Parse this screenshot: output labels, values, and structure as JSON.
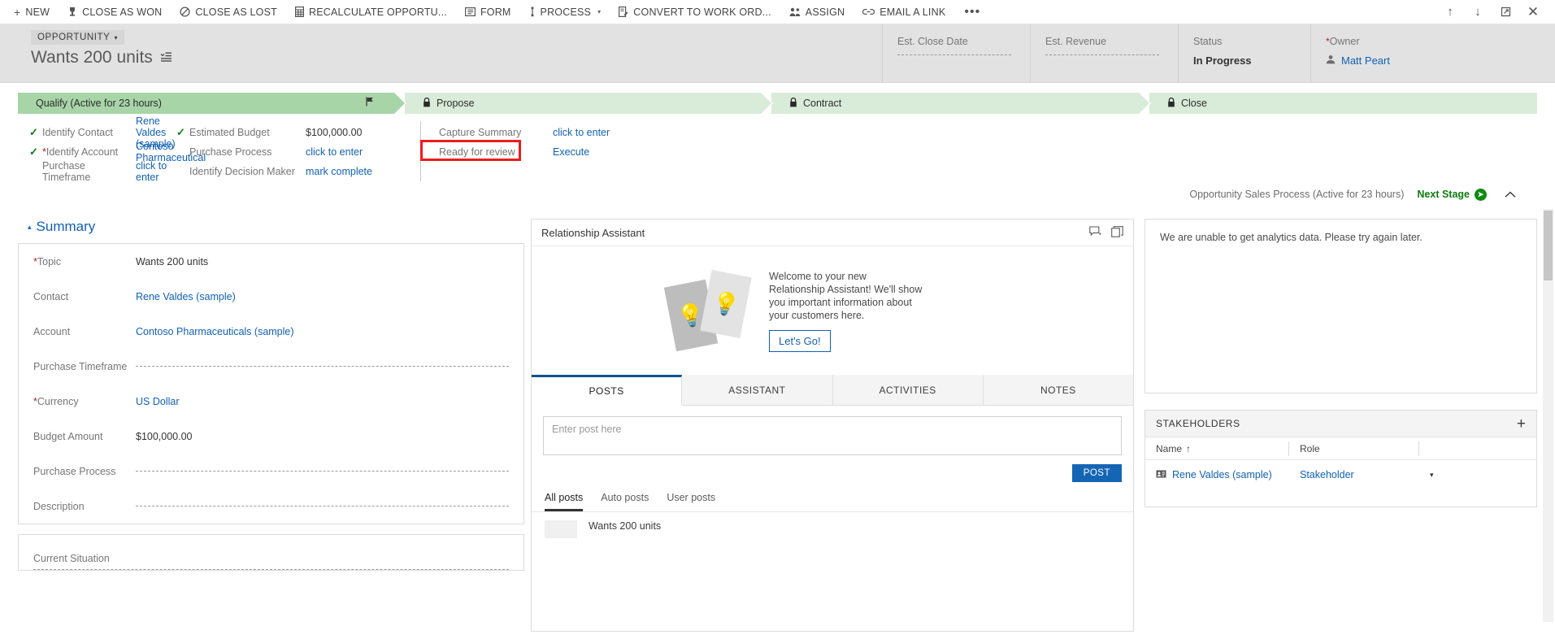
{
  "commandbar": {
    "items": [
      {
        "label": "NEW",
        "icon": "plus-icon",
        "glyph": "+"
      },
      {
        "label": "CLOSE AS WON",
        "icon": "trophy-icon",
        "glyph": "♟"
      },
      {
        "label": "CLOSE AS LOST",
        "icon": "no-entry-icon",
        "glyph": "⃠"
      },
      {
        "label": "RECALCULATE OPPORTU...",
        "icon": "calculator-icon",
        "glyph": "▤"
      },
      {
        "label": "FORM",
        "icon": "form-icon",
        "glyph": "▥"
      },
      {
        "label": "PROCESS",
        "icon": "process-icon",
        "glyph": "↕",
        "caret": "▾"
      },
      {
        "label": "CONVERT TO WORK ORD...",
        "icon": "work-order-icon",
        "glyph": "Ὅd"
      },
      {
        "label": "ASSIGN",
        "icon": "assign-user-icon",
        "glyph": "♟"
      },
      {
        "label": "EMAIL A LINK",
        "icon": "link-icon",
        "glyph": "∞"
      }
    ],
    "overflow_label": "•••",
    "right_icons": [
      {
        "name": "previous-record-icon",
        "glyph": "↑"
      },
      {
        "name": "next-record-icon",
        "glyph": "↓"
      },
      {
        "name": "popout-icon",
        "glyph": "⬚"
      },
      {
        "name": "close-icon",
        "glyph": "✕"
      }
    ]
  },
  "header": {
    "entity_label": "OPPORTUNITY",
    "entity_caret": "▾",
    "record_title": "Wants 200 units",
    "form_selector_icon": "form-selector-icon",
    "stats": [
      {
        "label": "Est. Close Date",
        "value": "",
        "empty": true
      },
      {
        "label": "Est. Revenue",
        "value": "",
        "empty": true
      },
      {
        "label": "Status",
        "value": "In Progress",
        "empty": false
      },
      {
        "label": "Owner",
        "value": "Matt Peart",
        "empty": false,
        "required": true,
        "link": true
      }
    ]
  },
  "bpf": {
    "stages": [
      {
        "label": "Qualify (Active for 23 hours)",
        "active": true,
        "locked": false
      },
      {
        "label": "Propose",
        "active": false,
        "locked": true
      },
      {
        "label": "Contract",
        "active": false,
        "locked": true
      },
      {
        "label": "Close",
        "active": false,
        "locked": true
      }
    ],
    "columns": [
      {
        "steps": [
          {
            "label": "Identify Contact",
            "value": "Rene Valdes (sample)",
            "complete": true,
            "required": false,
            "link": true
          },
          {
            "label": "Identify Account",
            "value": "Contoso Pharmaceutical",
            "complete": true,
            "required": true,
            "link": true
          },
          {
            "label": "Purchase Timeframe",
            "value": "click to enter",
            "complete": false,
            "required": false,
            "link": true
          }
        ]
      },
      {
        "steps": [
          {
            "label": "Estimated Budget",
            "value": "$100,000.00",
            "complete": true,
            "required": false,
            "link": false
          },
          {
            "label": "Purchase Process",
            "value": "click to enter",
            "complete": false,
            "required": false,
            "link": true
          },
          {
            "label": "Identify Decision Maker",
            "value": "mark complete",
            "complete": false,
            "required": false,
            "link": true
          }
        ]
      },
      {
        "steps": [
          {
            "label": "Capture Summary",
            "value": "click to enter",
            "complete": false,
            "required": false,
            "link": true
          },
          {
            "label": "Ready for review",
            "value": "Execute",
            "complete": false,
            "required": false,
            "link": true,
            "highlighted": true
          }
        ]
      }
    ],
    "process_name": "Opportunity Sales Process (Active for 23 hours)",
    "next_stage_label": "Next Stage",
    "next_stage_glyph": "➜",
    "collapse_glyph": "⌃"
  },
  "summary": {
    "section_title": "Summary",
    "section_caret": "▴",
    "fields": [
      {
        "label": "Topic",
        "value": "Wants 200 units",
        "required": true,
        "link": false,
        "empty": false
      },
      {
        "label": "Contact",
        "value": "Rene Valdes (sample)",
        "required": false,
        "link": true,
        "empty": false
      },
      {
        "label": "Account",
        "value": "Contoso Pharmaceuticals (sample)",
        "required": false,
        "link": true,
        "empty": false
      },
      {
        "label": "Purchase Timeframe",
        "value": "",
        "required": false,
        "link": false,
        "empty": true
      },
      {
        "label": "Currency",
        "value": "US Dollar",
        "required": true,
        "link": true,
        "empty": false
      },
      {
        "label": "Budget Amount",
        "value": "$100,000.00",
        "required": false,
        "link": false,
        "empty": false
      },
      {
        "label": "Purchase Process",
        "value": "",
        "required": false,
        "link": false,
        "empty": true
      },
      {
        "label": "Description",
        "value": "",
        "required": false,
        "link": false,
        "empty": true
      }
    ],
    "second_card": {
      "label": "Current Situation",
      "value": "",
      "empty": true
    }
  },
  "assistant": {
    "title": "Relationship Assistant",
    "icons": [
      {
        "name": "add-note-icon",
        "glyph": "⌨"
      },
      {
        "name": "cards-icon",
        "glyph": "⧉"
      }
    ],
    "welcome_line1": "Welcome to your new",
    "welcome_line2": "Relationship Assistant! We'll show",
    "welcome_line3": "you important information about",
    "welcome_line4": "your customers here.",
    "cta_label": "Let's Go!",
    "bulb_icon": "lightbulb-icon"
  },
  "social": {
    "tabs": [
      {
        "label": "POSTS",
        "active": true
      },
      {
        "label": "ASSISTANT",
        "active": false
      },
      {
        "label": "ACTIVITIES",
        "active": false
      },
      {
        "label": "NOTES",
        "active": false
      }
    ],
    "post_placeholder": "Enter post here",
    "post_button": "POST",
    "filters": [
      {
        "label": "All posts",
        "active": true
      },
      {
        "label": "Auto posts",
        "active": false
      },
      {
        "label": "User posts",
        "active": false
      }
    ],
    "first_post_title": "Wants 200 units"
  },
  "analytics": {
    "message": "We are unable to get analytics data. Please try again later."
  },
  "stakeholders": {
    "title": "STAKEHOLDERS",
    "add_icon": "plus-icon",
    "columns": [
      {
        "label": "Name",
        "sort": "↑"
      },
      {
        "label": "Role",
        "sort": ""
      }
    ],
    "rows": [
      {
        "name": "Rene Valdes (sample)",
        "role": "Stakeholder",
        "row_icon": "contact-card-icon",
        "menu": "▾"
      }
    ]
  },
  "colors": {
    "accent_blue": "#1160b7",
    "stage_active_green": "#a8d5a8",
    "stage_green": "#d9ebd9",
    "highlight_red": "#ee1c1c",
    "post_button_blue": "#1565b5",
    "required_red": "#b61d1d",
    "check_green": "#107c10"
  }
}
